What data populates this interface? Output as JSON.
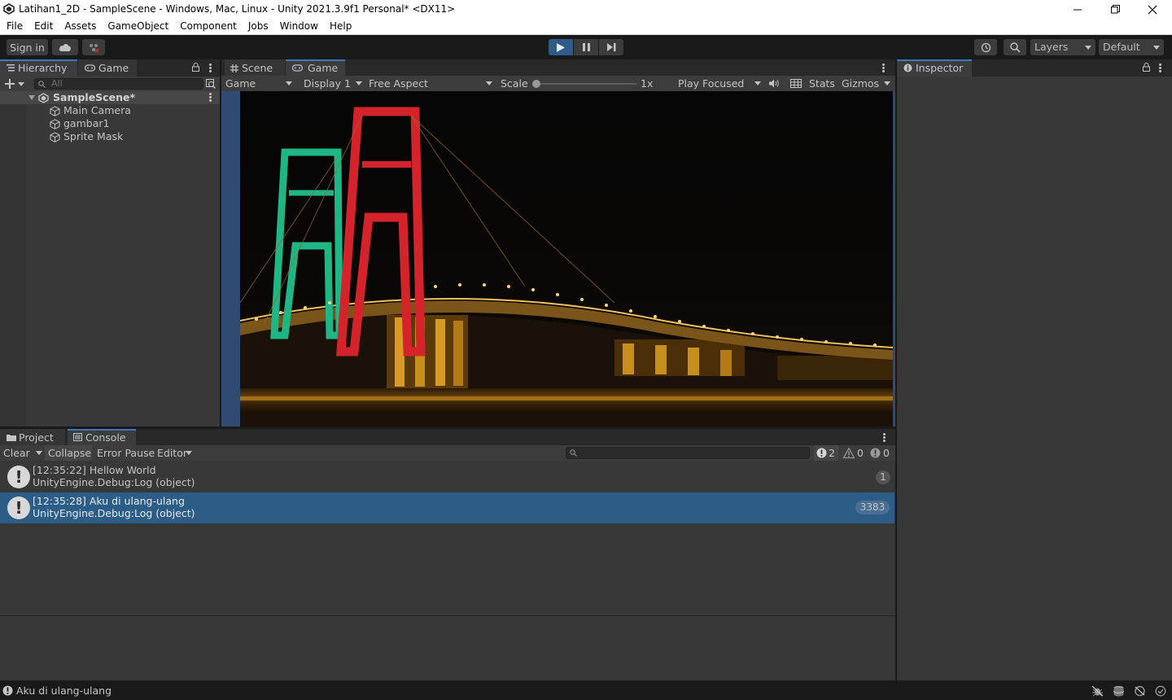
{
  "window": {
    "title": "Latihan1_2D - SampleScene - Windows, Mac, Linux - Unity 2021.3.9f1 Personal* <DX11>"
  },
  "menu": [
    "File",
    "Edit",
    "Assets",
    "GameObject",
    "Component",
    "Jobs",
    "Window",
    "Help"
  ],
  "toolbar": {
    "sign_in": "Sign in",
    "layers": "Layers",
    "layout": "Default",
    "play_mode_active": true
  },
  "hierarchy": {
    "tab_label": "Hierarchy",
    "second_tab": "Game",
    "search_placeholder": "All",
    "scene_name": "SampleScene*",
    "objects": [
      "Main Camera",
      "gambar1",
      "Sprite Mask"
    ]
  },
  "center": {
    "tabs": [
      "Scene",
      "Game"
    ],
    "active_tab": "Game",
    "game_dropdown": "Game",
    "display": "Display 1",
    "aspect": "Free Aspect",
    "scale_label": "Scale",
    "scale_value": "1x",
    "play_focused": "Play Focused",
    "stats": "Stats",
    "gizmos": "Gizmos"
  },
  "inspector": {
    "tab_label": "Inspector"
  },
  "console": {
    "tabs": [
      "Project",
      "Console"
    ],
    "clear": "Clear",
    "collapse": "Collapse",
    "error_pause": "Error Pause",
    "editor": "Editor",
    "counts": {
      "info": "2",
      "warnings": "0",
      "errors": "0"
    },
    "entries": [
      {
        "message": "[12:35:22] Hellow World",
        "source": "UnityEngine.Debug:Log (object)",
        "count": "1",
        "selected": false
      },
      {
        "message": "[12:35:28] Aku di ulang-ulang",
        "source": "UnityEngine.Debug:Log (object)",
        "count": "3383",
        "selected": true
      }
    ]
  },
  "status_bar": {
    "message": "Aku di ulang-ulang"
  },
  "colors": {
    "accent": "#3a79bb",
    "selection": "#2c5d87",
    "panel": "#383838",
    "background": "#191919"
  }
}
